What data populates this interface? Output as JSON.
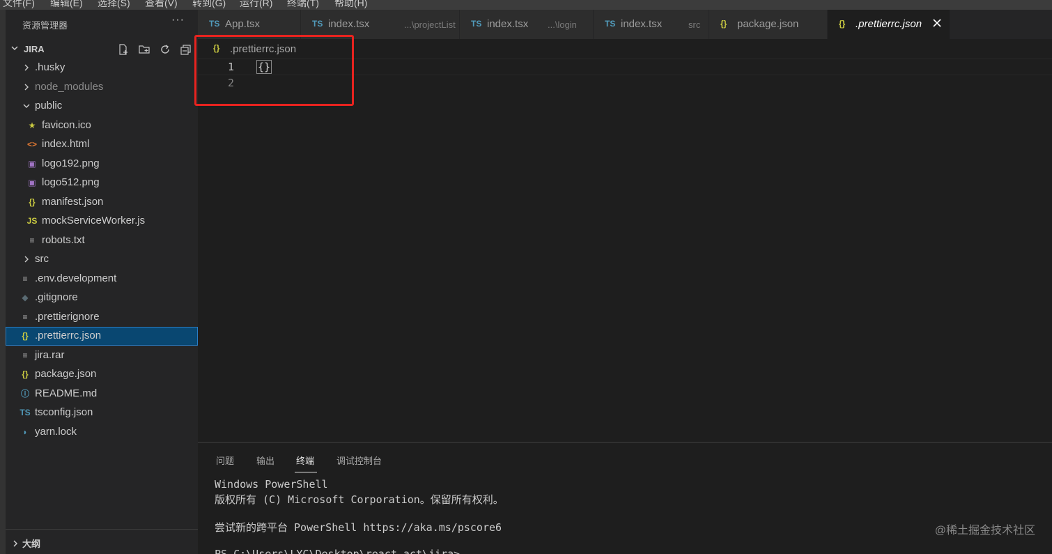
{
  "menubar": {
    "items": [
      "文件(F)",
      "编辑(E)",
      "选择(S)",
      "查看(V)",
      "转到(G)",
      "运行(R)",
      "终端(T)",
      "帮助(H)"
    ]
  },
  "sidebar": {
    "title": "资源管理器",
    "more": "···",
    "project": "JIRA",
    "tree": [
      {
        "label": ".husky",
        "type": "folder",
        "expanded": false,
        "depth": 0
      },
      {
        "label": "node_modules",
        "type": "folder",
        "expanded": false,
        "depth": 0,
        "dim": true
      },
      {
        "label": "public",
        "type": "folder",
        "expanded": true,
        "depth": 0
      },
      {
        "label": "favicon.ico",
        "type": "star",
        "depth": 1
      },
      {
        "label": "index.html",
        "type": "html",
        "depth": 1
      },
      {
        "label": "logo192.png",
        "type": "image",
        "depth": 1
      },
      {
        "label": "logo512.png",
        "type": "image",
        "depth": 1
      },
      {
        "label": "manifest.json",
        "type": "json",
        "depth": 1
      },
      {
        "label": "mockServiceWorker.js",
        "type": "js",
        "depth": 1
      },
      {
        "label": "robots.txt",
        "type": "text",
        "depth": 1
      },
      {
        "label": "src",
        "type": "folder",
        "expanded": false,
        "depth": 0
      },
      {
        "label": ".env.development",
        "type": "text",
        "depth": 0
      },
      {
        "label": ".gitignore",
        "type": "git",
        "depth": 0
      },
      {
        "label": ".prettierignore",
        "type": "text",
        "depth": 0
      },
      {
        "label": ".prettierrc.json",
        "type": "json",
        "depth": 0,
        "selected": true
      },
      {
        "label": "jira.rar",
        "type": "text",
        "depth": 0
      },
      {
        "label": "package.json",
        "type": "json",
        "depth": 0
      },
      {
        "label": "README.md",
        "type": "info",
        "depth": 0
      },
      {
        "label": "tsconfig.json",
        "type": "ts",
        "depth": 0
      },
      {
        "label": "yarn.lock",
        "type": "yarn",
        "depth": 0
      }
    ],
    "outline": "大纲"
  },
  "tabs": [
    {
      "name": "App.tsx",
      "desc": "",
      "icon": "TS",
      "active": false
    },
    {
      "name": "index.tsx",
      "desc": "...\\projectList",
      "icon": "TS",
      "active": false
    },
    {
      "name": "index.tsx",
      "desc": "...\\login",
      "icon": "TS",
      "active": false
    },
    {
      "name": "index.tsx",
      "desc": "src",
      "icon": "TS",
      "active": false
    },
    {
      "name": "package.json",
      "desc": "",
      "icon": "{}",
      "active": false
    },
    {
      "name": ".prettierrc.json",
      "desc": "",
      "icon": "{}",
      "active": true
    }
  ],
  "breadcrumb": {
    "icon": "{}",
    "file": ".prettierrc.json"
  },
  "editor": {
    "lines": [
      {
        "number": "1",
        "text": "{}"
      },
      {
        "number": "2",
        "text": ""
      }
    ]
  },
  "panel": {
    "tabs": [
      "问题",
      "输出",
      "终端",
      "调试控制台"
    ],
    "active_tab": "终端",
    "terminal": [
      "Windows PowerShell",
      "版权所有 (C) Microsoft Corporation。保留所有权利。",
      "",
      "尝试新的跨平台 PowerShell https://aka.ms/pscore6",
      "",
      "PS C:\\Users\\LYC\\Desktop\\react-act\\jira>"
    ]
  },
  "watermark": "@稀土掘金技术社区",
  "colors": {
    "ts": "#519aba",
    "json": "#cbcb41",
    "html": "#e37933",
    "image": "#a074c4",
    "star": "#cbcb41",
    "selection": "#094771",
    "annotation": "#e8231f"
  }
}
